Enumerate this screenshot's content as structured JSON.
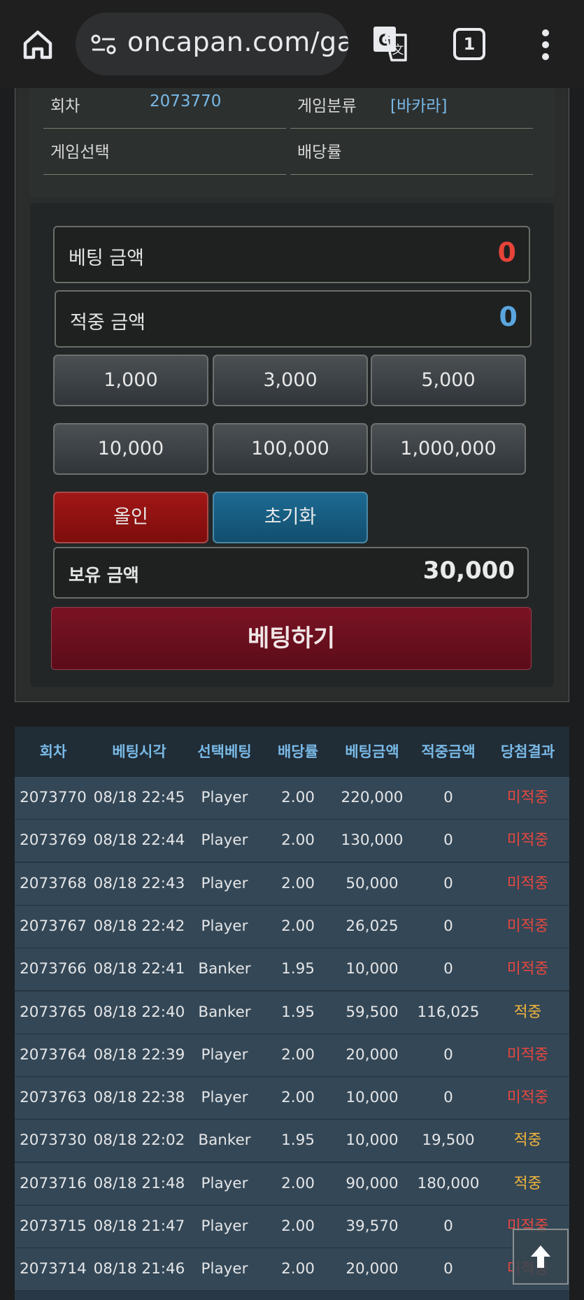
{
  "browser": {
    "url": "oncapan.com/ga",
    "tab_count": "1",
    "colors": {
      "bar": "#1f1f1f",
      "url_pill": "#2d2f31"
    },
    "icons": [
      "home-icon",
      "site-settings-icon",
      "translate-icon",
      "tabs-icon",
      "overflow-menu-icon"
    ]
  },
  "info": {
    "round_label": "회차",
    "round_value": "2073770",
    "category_label": "게임분류",
    "category_value": "[바카라]",
    "selection_label": "게임선택",
    "selection_value": "",
    "odds_label": "배당률",
    "odds_value": ""
  },
  "bet_form": {
    "bet_amount_label": "베팅 금액",
    "bet_amount_value": "0",
    "win_amount_label": "적중 금액",
    "win_amount_value": "0",
    "chips": [
      "1,000",
      "3,000",
      "5,000",
      "10,000",
      "100,000",
      "1,000,000"
    ],
    "allin_label": "올인",
    "reset_label": "초기화",
    "balance_label": "보유 금액",
    "balance_value": "30,000",
    "submit_label": "베팅하기",
    "colors": {
      "bet_value": "#e64339",
      "win_value": "#5aa6df",
      "allin": "#8f1312",
      "reset": "#17597e",
      "submit": "#6d1020"
    }
  },
  "history": {
    "headers": [
      "회차",
      "베팅시각",
      "선택베팅",
      "배당률",
      "베팅금액",
      "적중금액",
      "당첨결과"
    ],
    "rows": [
      [
        "2073770",
        "08/18 22:45",
        "Player",
        "2.00",
        "220,000",
        "0",
        "미적중"
      ],
      [
        "2073769",
        "08/18 22:44",
        "Player",
        "2.00",
        "130,000",
        "0",
        "미적중"
      ],
      [
        "2073768",
        "08/18 22:43",
        "Player",
        "2.00",
        "50,000",
        "0",
        "미적중"
      ],
      [
        "2073767",
        "08/18 22:42",
        "Player",
        "2.00",
        "26,025",
        "0",
        "미적중"
      ],
      [
        "2073766",
        "08/18 22:41",
        "Banker",
        "1.95",
        "10,000",
        "0",
        "미적중"
      ],
      [
        "2073765",
        "08/18 22:40",
        "Banker",
        "1.95",
        "59,500",
        "116,025",
        "적중"
      ],
      [
        "2073764",
        "08/18 22:39",
        "Player",
        "2.00",
        "20,000",
        "0",
        "미적중"
      ],
      [
        "2073763",
        "08/18 22:38",
        "Player",
        "2.00",
        "10,000",
        "0",
        "미적중"
      ],
      [
        "2073730",
        "08/18 22:02",
        "Banker",
        "1.95",
        "10,000",
        "19,500",
        "적중"
      ],
      [
        "2073716",
        "08/18 21:48",
        "Player",
        "2.00",
        "90,000",
        "180,000",
        "적중"
      ],
      [
        "2073715",
        "08/18 21:47",
        "Player",
        "2.00",
        "39,570",
        "0",
        "미적중"
      ],
      [
        "2073714",
        "08/18 21:46",
        "Player",
        "2.00",
        "20,000",
        "0",
        "미적중"
      ]
    ],
    "colors": {
      "lose": "#e8473f",
      "win": "#f1b53c",
      "header": "#79b9e6"
    }
  },
  "scroll_top_icon": "arrow-up-icon"
}
